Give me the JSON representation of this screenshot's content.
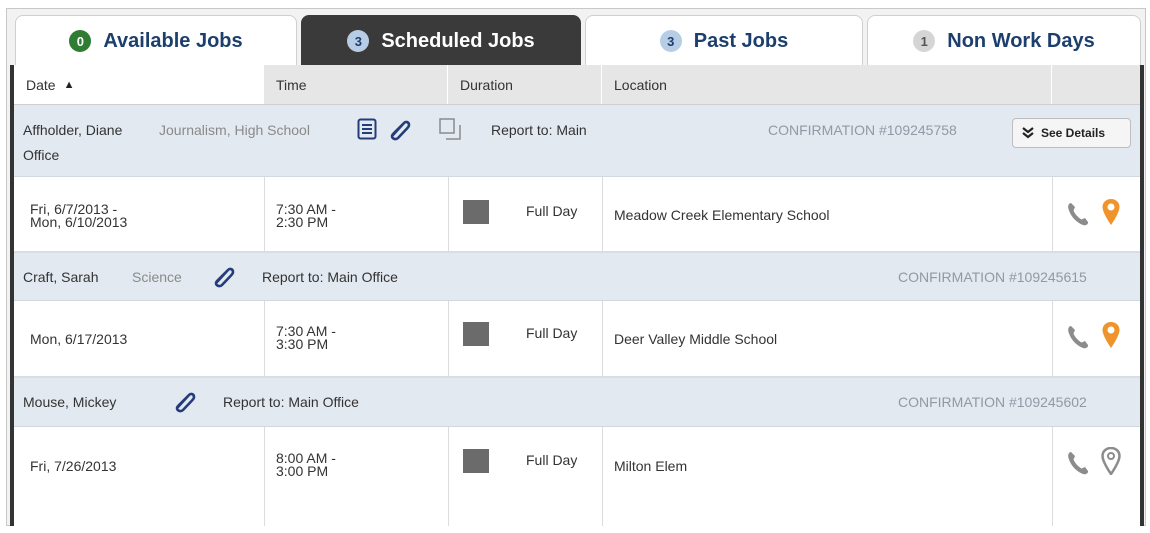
{
  "tabs": [
    {
      "label": "Available Jobs",
      "count": "0"
    },
    {
      "label": "Scheduled Jobs",
      "count": "3"
    },
    {
      "label": "Past Jobs",
      "count": "3"
    },
    {
      "label": "Non Work Days",
      "count": "1"
    }
  ],
  "columns": {
    "date": "Date",
    "time": "Time",
    "duration": "Duration",
    "location": "Location"
  },
  "sort_indicator": "▲",
  "see_details_label": "See Details",
  "jobs": [
    {
      "name": "Affholder, Diane",
      "subject": "Journalism, High School",
      "report_to_line1": "Report to: Main",
      "report_to_line2": "Office",
      "confirmation": "CONFIRMATION #109245758",
      "date_line1": "Fri, 6/7/2013 -",
      "date_line2": "Mon, 6/10/2013",
      "time_line1": "7:30 AM -",
      "time_line2": "2:30 PM",
      "duration": "Full Day",
      "location": "Meadow Creek Elementary School"
    },
    {
      "name": "Craft, Sarah",
      "subject": "Science",
      "report_to": "Report to: Main Office",
      "confirmation": "CONFIRMATION #109245615",
      "date": "Mon, 6/17/2013",
      "time_line1": "7:30 AM -",
      "time_line2": "3:30 PM",
      "duration": "Full Day",
      "location": "Deer Valley Middle School"
    },
    {
      "name": "Mouse, Mickey",
      "report_to": "Report to: Main Office",
      "confirmation": "CONFIRMATION #109245602",
      "date": "Fri, 7/26/2013",
      "time_line1": "8:00 AM -",
      "time_line2": "3:00 PM",
      "duration": "Full Day",
      "location": "Milton Elem"
    }
  ],
  "colors": {
    "tab_active_bg": "#3a3a3a",
    "tab_text": "#1c3f6e",
    "badge_available": "#2e7d32",
    "group_row_bg": "#e3e9f0",
    "location_pin_active": "#f0932b",
    "location_pin_inactive": "#8c8c8c",
    "phone_icon": "#8c8c8c",
    "icon_blue": "#253c7a"
  }
}
